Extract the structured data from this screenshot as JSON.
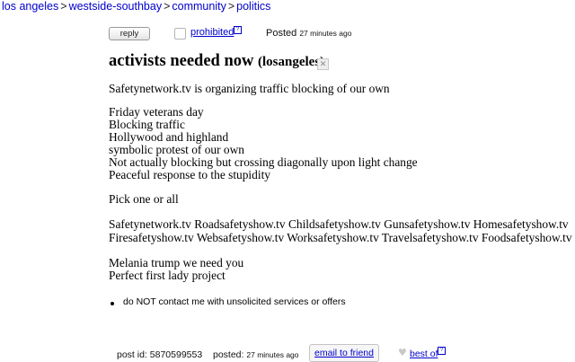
{
  "breadcrumb": {
    "items": [
      "los angeles",
      "westside-southbay",
      "community",
      "politics"
    ],
    "separator": ">"
  },
  "actions": {
    "reply_label": "reply",
    "prohibited_label": "prohibited",
    "help_glyph": "?",
    "posted_label": "Posted",
    "posted_time": "27 minutes ago"
  },
  "post": {
    "title": "activists needed now",
    "location": "(losangeles)",
    "close_glyph": "✕",
    "lines": [
      "Safetynetwork.tv is organizing traffic blocking of our own",
      "Friday veterans day",
      "Blocking traffic",
      "Hollywood and highland",
      "symbolic protest of our own",
      "Not actually blocking but crossing diagonally upon light change",
      "Peaceful response to the stupidity",
      "Pick one or all",
      "Safetynetwork.tv Roadsafetyshow.tv Childsafetyshow.tv Gunsafetyshow.tv Homesafetyshow.tv",
      "Firesafetyshow.tv Websafetyshow.tv Worksafetyshow.tv Travelsafetyshow.tv Foodsafetyshow.tv",
      "Melania trump we need you",
      "Perfect first lady project"
    ],
    "notice": "do NOT contact me with unsolicited services or offers"
  },
  "footer": {
    "post_id_label": "post id:",
    "post_id": "5870599553",
    "posted_label": "posted:",
    "posted_time": "27 minutes ago",
    "email_friend_label": "email to friend",
    "heart_glyph": "♥",
    "best_of_label": "best of"
  },
  "colors": {
    "link": "#0000cc",
    "text": "#000000",
    "background": "#ffffff"
  }
}
